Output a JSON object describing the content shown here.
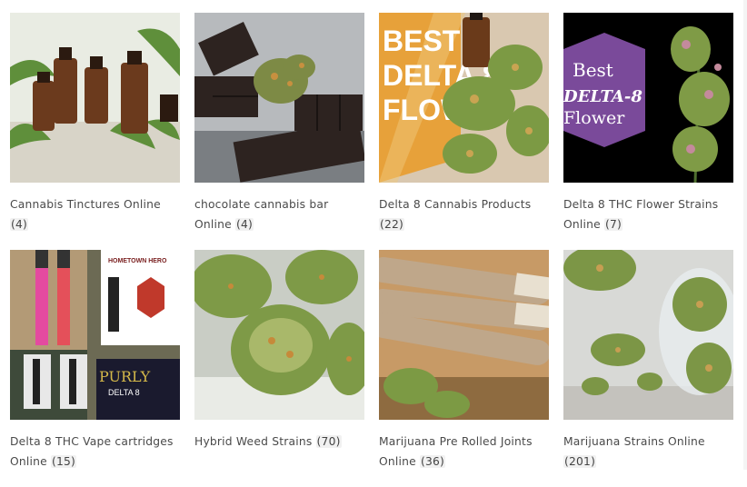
{
  "categories": [
    {
      "name": "Cannabis Tinctures Online",
      "count": "(4)",
      "image": "tincture-bottles-image"
    },
    {
      "name": "chocolate cannabis bar Online",
      "count": "(4)",
      "image": "chocolate-bar-image"
    },
    {
      "name": "Delta 8 Cannabis Products",
      "count": "(22)",
      "image": "delta8-products-image",
      "overlay": [
        "BEST",
        "DELTA 8",
        "FLOWER"
      ]
    },
    {
      "name": "Delta 8 THC Flower Strains Online",
      "count": "(7)",
      "image": "delta8-flower-image",
      "overlay": [
        "Best",
        "DELTA-8",
        "Flower"
      ]
    },
    {
      "name": "Delta 8 THC Vape cartridges Online",
      "count": "(15)",
      "image": "vape-cartridges-image",
      "overlay": [
        "HOMETOWN HERO",
        "PURLY",
        "DELTA 8"
      ]
    },
    {
      "name": "Hybrid Weed Strains",
      "count": "(70)",
      "image": "hybrid-weed-image"
    },
    {
      "name": "Marijuana Pre Rolled Joints Online",
      "count": "(36)",
      "image": "pre-rolled-joints-image"
    },
    {
      "name": "Marijuana Strains Online",
      "count": "(201)",
      "image": "marijuana-strains-image"
    }
  ]
}
